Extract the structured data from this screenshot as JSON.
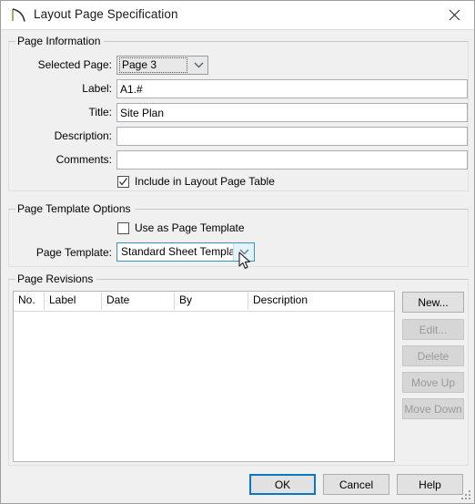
{
  "window": {
    "title": "Layout Page Specification",
    "icon": "layout-page-icon",
    "close_icon": "close-icon"
  },
  "page_information": {
    "group_label": "Page Information",
    "selected_page": {
      "label": "Selected Page:",
      "value": "Page 3",
      "arrow_icon": "chevron-down-icon"
    },
    "label_field": {
      "label": "Label:",
      "value": "A1.#",
      "placeholder": ""
    },
    "title_field": {
      "label": "Title:",
      "value": "Site Plan",
      "placeholder": ""
    },
    "description_field": {
      "label": "Description:",
      "value": "",
      "placeholder": ""
    },
    "comments_field": {
      "label": "Comments:",
      "value": "",
      "placeholder": ""
    },
    "include_checkbox": {
      "label": "Include in Layout Page Table",
      "checked": true
    }
  },
  "page_template_options": {
    "group_label": "Page Template Options",
    "use_as_template_checkbox": {
      "label": "Use as Page Template",
      "checked": false
    },
    "page_template": {
      "label": "Page Template:",
      "value": "Standard Sheet Template",
      "arrow_icon": "chevron-down-icon"
    }
  },
  "page_revisions": {
    "group_label": "Page Revisions",
    "columns": [
      "No.",
      "Label",
      "Date",
      "By",
      "Description"
    ],
    "rows": [],
    "buttons": [
      {
        "label": "New...",
        "enabled": true
      },
      {
        "label": "Edit...",
        "enabled": false
      },
      {
        "label": "Delete",
        "enabled": false
      },
      {
        "label": "Move Up",
        "enabled": false
      },
      {
        "label": "Move Down",
        "enabled": false
      }
    ]
  },
  "footer": {
    "ok": "OK",
    "cancel": "Cancel",
    "help": "Help"
  },
  "colors": {
    "dialog_bg": "#f0f0f0",
    "titlebar_bg": "#ffffff",
    "accent_blue": "#0a77c4",
    "combo_hover_border": "#3c93c2",
    "combo_hover_arrow_bg": "#e4f2f9",
    "input_border": "#abadb3",
    "button_bg": "#e1e1e1",
    "disabled_text": "#9a9a9a"
  }
}
